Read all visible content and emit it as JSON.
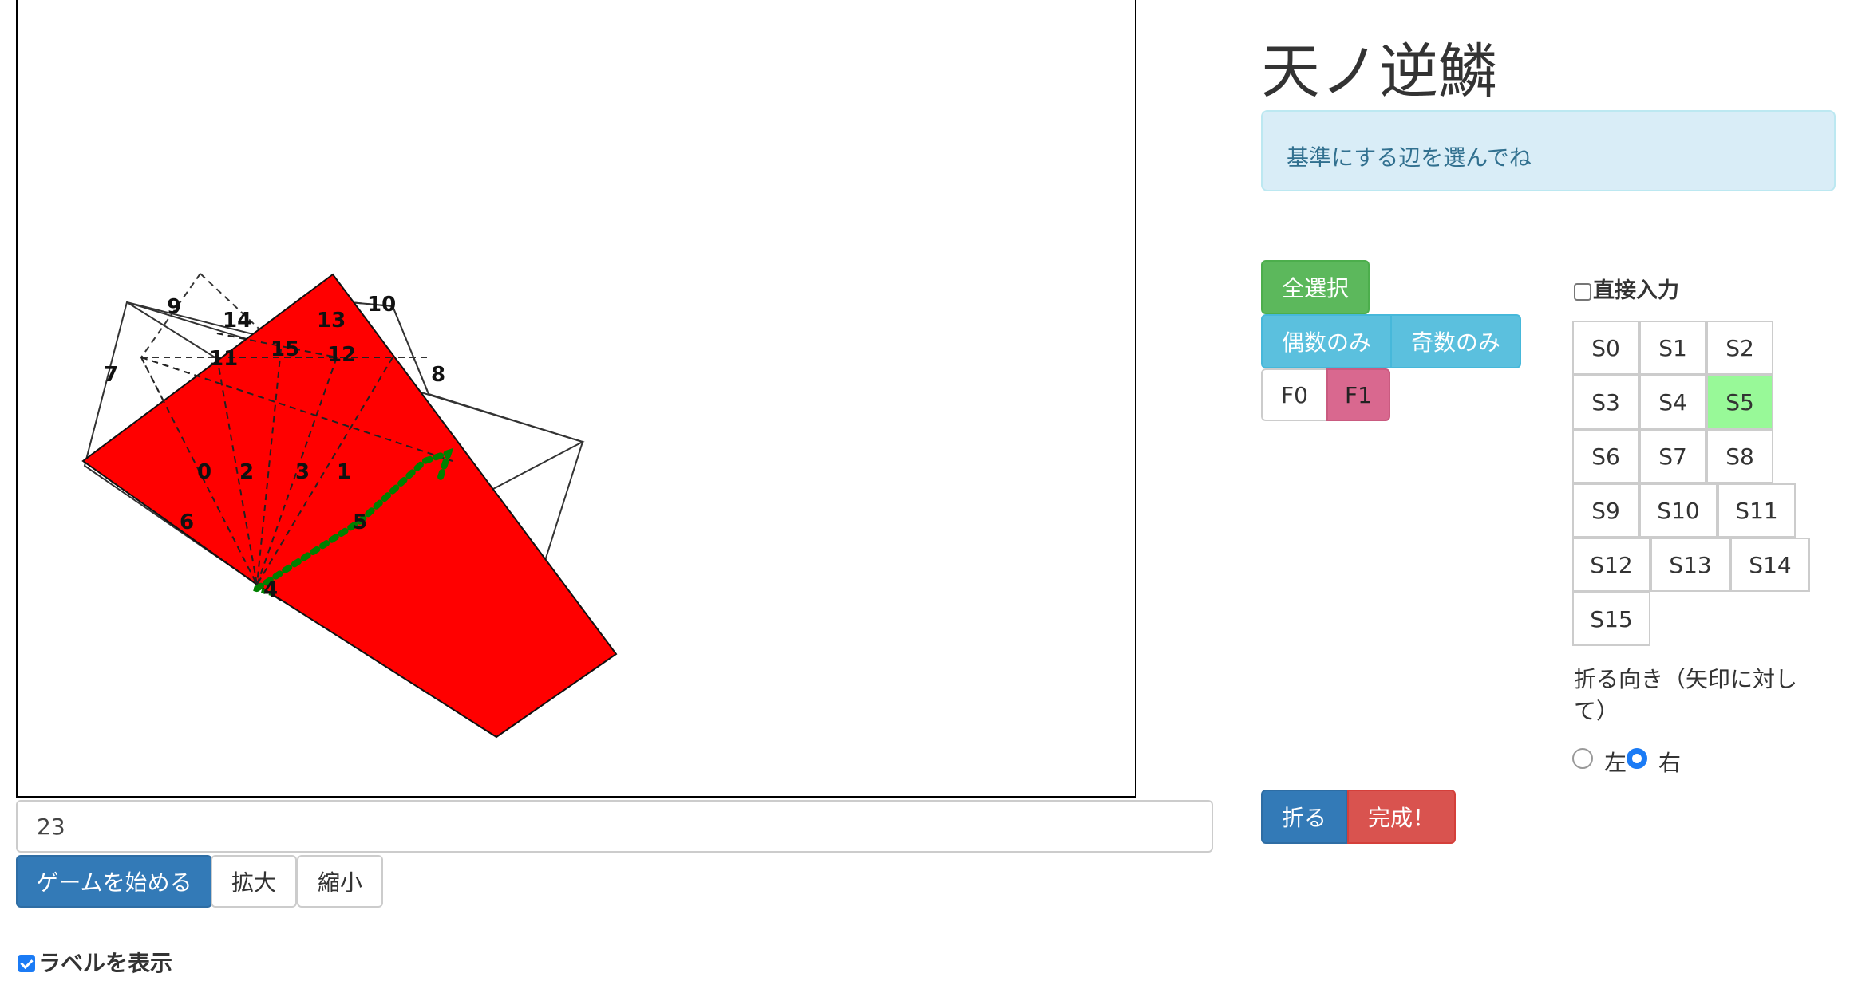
{
  "canvas": {
    "labels": [
      "0",
      "1",
      "2",
      "3",
      "4",
      "5",
      "6",
      "7",
      "8",
      "9",
      "10",
      "11",
      "12",
      "13",
      "14",
      "15"
    ]
  },
  "controls": {
    "number_value": "23",
    "start_label": "ゲームを始める",
    "zoom_in_label": "拡大",
    "zoom_out_label": "縮小",
    "show_labels_text": "ラベルを表示",
    "show_labels_checked": true
  },
  "panel": {
    "title": "天ノ逆鱗",
    "message": "基準にする辺を選んでね",
    "select_all": "全選択",
    "even_only": "偶数のみ",
    "odd_only": "奇数のみ",
    "faces": [
      "F0",
      "F1"
    ],
    "direct_input_label": "直接入力",
    "direct_input_checked": false,
    "segments": [
      "S0",
      "S1",
      "S2",
      "S3",
      "S4",
      "S5",
      "S6",
      "S7",
      "S8",
      "S9",
      "S10",
      "S11",
      "S12",
      "S13",
      "S14",
      "S15"
    ],
    "selected_segment": "S5",
    "fold_direction_label": "折る向き（矢印に対して）",
    "direction_left": "左",
    "direction_right": "右",
    "direction_selected": "右",
    "fold_button": "折る",
    "done_button": "完成！"
  },
  "colors": {
    "paper_face": "#ff0000",
    "selected_edge": "#008000",
    "face_active": "#d9688f",
    "segment_selected": "#98f998"
  }
}
